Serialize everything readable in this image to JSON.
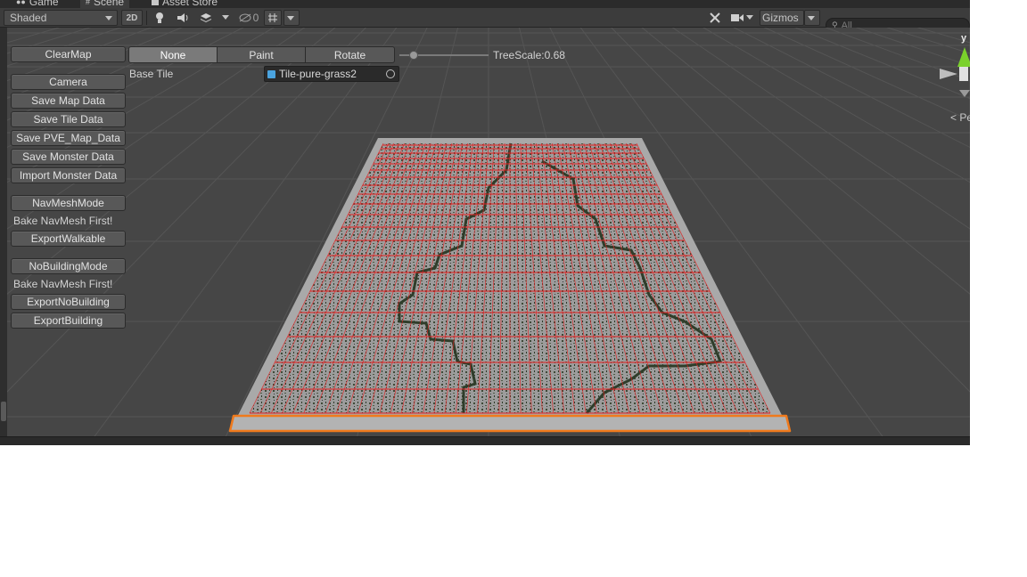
{
  "tabs": [
    {
      "label": "Game",
      "icon": "gamepad-icon"
    },
    {
      "label": "Scene",
      "icon": "scene-icon"
    },
    {
      "label": "Asset Store",
      "icon": "store-icon"
    }
  ],
  "toolbar": {
    "shading_mode": "Shaded",
    "mode_2d": "2D",
    "hidden_count": "0",
    "gizmos": "Gizmos",
    "search_placeholder": "All"
  },
  "map_tools": {
    "clear_map": "ClearMap",
    "modes": [
      "None",
      "Paint",
      "Rotate"
    ],
    "selected_mode": "None",
    "tree_scale_label": "TreeScale:0.68",
    "tree_scale_value": 0.68,
    "base_tile_label": "Base Tile",
    "base_tile_value": "Tile-pure-grass2",
    "buttons": {
      "camera": "Camera",
      "save_map": "Save Map Data",
      "save_tile": "Save Tile Data",
      "save_pve": "Save PVE_Map_Data",
      "save_monster": "Save Monster Data",
      "import_monster": "Import Monster Data",
      "navmesh_mode": "NavMeshMode",
      "export_walkable": "ExportWalkable",
      "nobuilding_mode": "NoBuildingMode",
      "export_nobuilding": "ExportNoBuilding",
      "export_building": "ExportBuilding"
    },
    "bake_hint_1": "Bake NavMesh First!",
    "bake_hint_2": "Bake NavMesh First!"
  },
  "gizmo": {
    "axis_label": "y",
    "projection": "Pe"
  },
  "colors": {
    "grid_line": "#e52020",
    "selection_outline": "#f07a1c",
    "axis_y": "#7ad12b"
  }
}
